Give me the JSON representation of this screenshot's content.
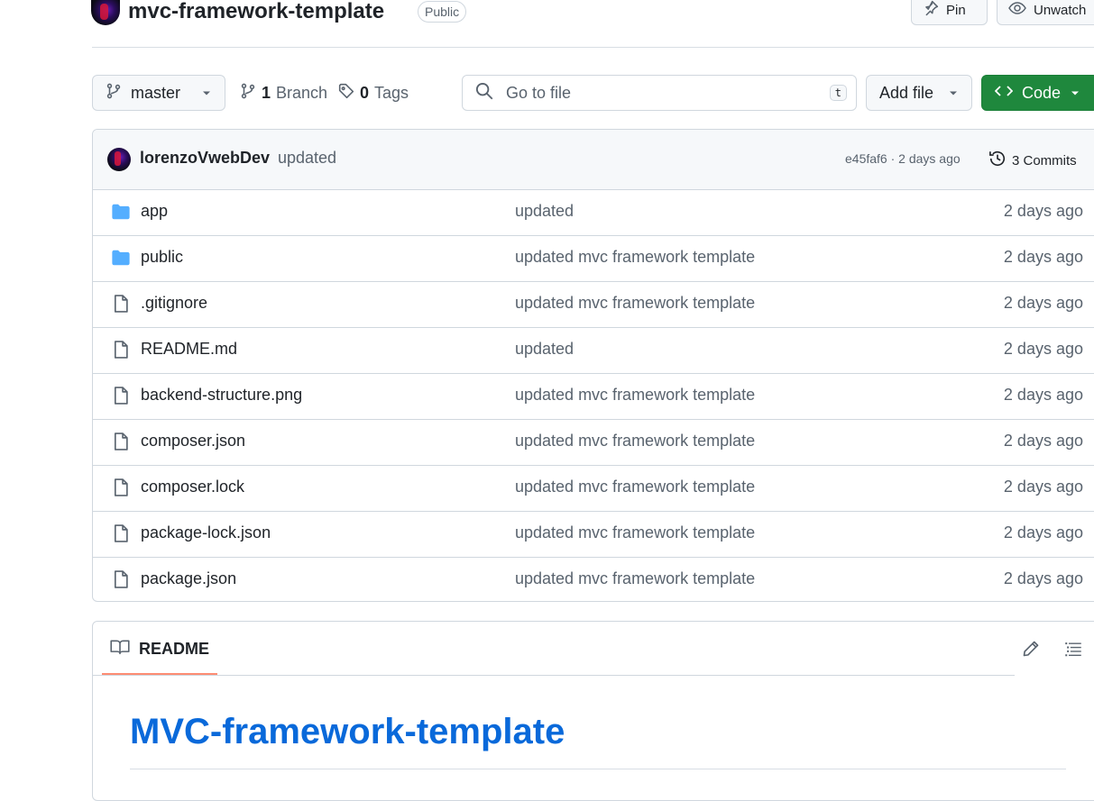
{
  "repo": {
    "name": "mvc-framework-template",
    "visibility": "Public"
  },
  "header_actions": {
    "pin_label": "Pin",
    "watch_label": "Unwatch"
  },
  "toolbar": {
    "branch_name": "master",
    "branch_count": "1",
    "branch_label": "Branch",
    "tag_count": "0",
    "tag_label": "Tags",
    "search_placeholder": "Go to file",
    "search_shortcut": "t",
    "add_file_label": "Add file",
    "code_label": "Code"
  },
  "latest_commit": {
    "author": "lorenzoVwebDev",
    "message": "updated",
    "meta": "e45faf6 · 2 days ago",
    "commits_label": "3 Commits"
  },
  "files": [
    {
      "name": "app",
      "type": "folder",
      "message": "updated",
      "date": "2 days ago"
    },
    {
      "name": "public",
      "type": "folder",
      "message": "updated mvc framework template",
      "date": "2 days ago"
    },
    {
      "name": ".gitignore",
      "type": "file",
      "message": "updated mvc framework template",
      "date": "2 days ago"
    },
    {
      "name": "README.md",
      "type": "file",
      "message": "updated",
      "date": "2 days ago"
    },
    {
      "name": "backend-structure.png",
      "type": "file",
      "message": "updated mvc framework template",
      "date": "2 days ago"
    },
    {
      "name": "composer.json",
      "type": "file",
      "message": "updated mvc framework template",
      "date": "2 days ago"
    },
    {
      "name": "composer.lock",
      "type": "file",
      "message": "updated mvc framework template",
      "date": "2 days ago"
    },
    {
      "name": "package-lock.json",
      "type": "file",
      "message": "updated mvc framework template",
      "date": "2 days ago"
    },
    {
      "name": "package.json",
      "type": "file",
      "message": "updated mvc framework template",
      "date": "2 days ago"
    }
  ],
  "readme": {
    "tab_label": "README",
    "heading": "MVC-framework-template"
  },
  "colors": {
    "primary_button": "#1f883d",
    "folder_icon": "#54aeff",
    "link": "#0969da",
    "tab_underline": "#fd8c73"
  }
}
